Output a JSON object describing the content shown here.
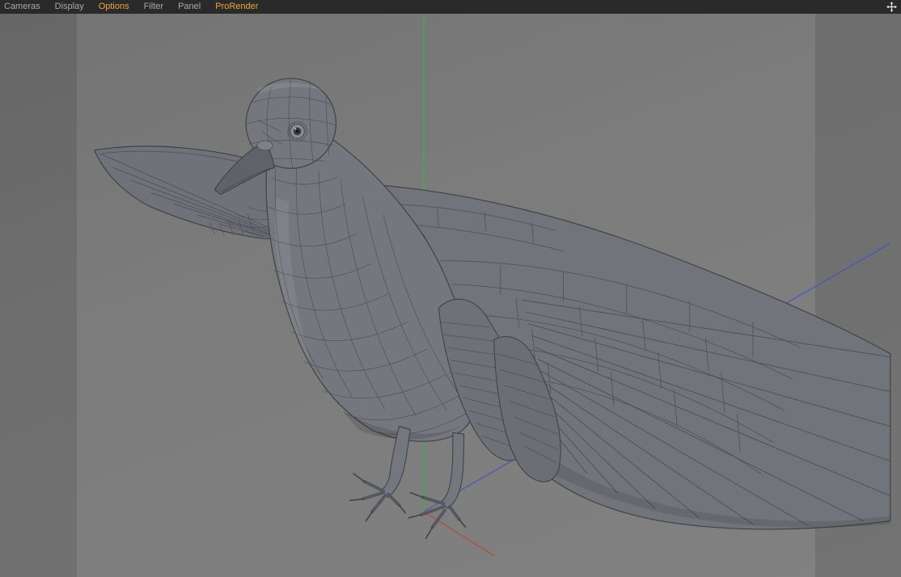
{
  "menu": {
    "items": [
      {
        "label": "Cameras",
        "active": false
      },
      {
        "label": "Display",
        "active": false
      },
      {
        "label": "Options",
        "active": true
      },
      {
        "label": "Filter",
        "active": false
      },
      {
        "label": "Panel",
        "active": false
      },
      {
        "label": "ProRender",
        "active": true
      }
    ]
  },
  "icons": {
    "pan_move_icon": "four-arrow-move-cross"
  },
  "viewport": {
    "model_label": "wireframe pigeon mesh, wings spread"
  },
  "colors": {
    "menubar_bg": "#2a2a2a",
    "menu_inactive": "#a8a8a8",
    "menu_active": "#e8a83a",
    "viewport_bg": "#7d7d7d",
    "viewport_side_tint": "#6f6f6f",
    "axis_x_red": "#b5473a",
    "axis_y_green": "#3fae3f",
    "axis_z_blue": "#4653c4",
    "model_fill": "#74777d",
    "model_wire": "#46484e"
  }
}
